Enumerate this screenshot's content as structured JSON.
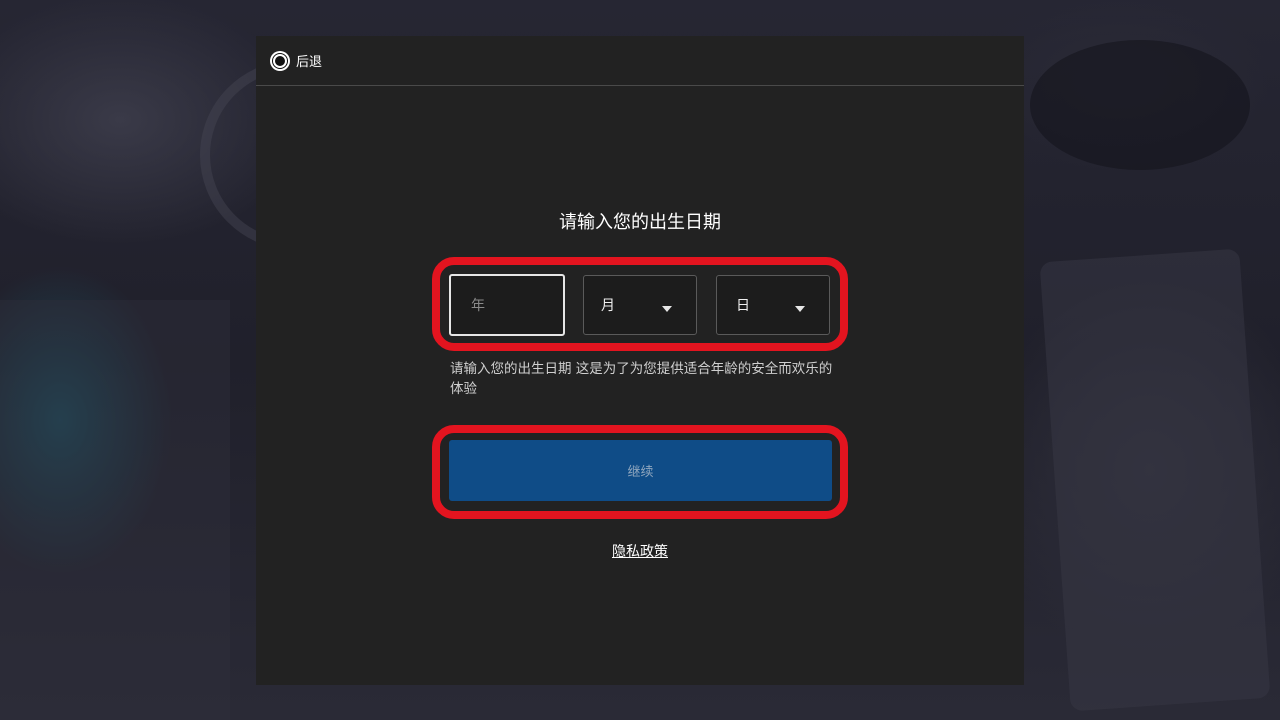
{
  "header": {
    "back_label": "后退",
    "back_icon": "record-circle-icon"
  },
  "form": {
    "title": "请输入您的出生日期",
    "year_placeholder": "年",
    "month_value": "月",
    "day_value": "日",
    "dropdown_icon": "caret-down-icon",
    "helper_text": "请输入您的出生日期 这是为了为您提供适合年龄的安全而欢乐的体验",
    "continue_label": "继续",
    "privacy_label": "隐私政策"
  },
  "colors": {
    "dialog_bg": "#222222",
    "button_blue": "#0f4c87",
    "highlight_red": "#e3141f"
  }
}
